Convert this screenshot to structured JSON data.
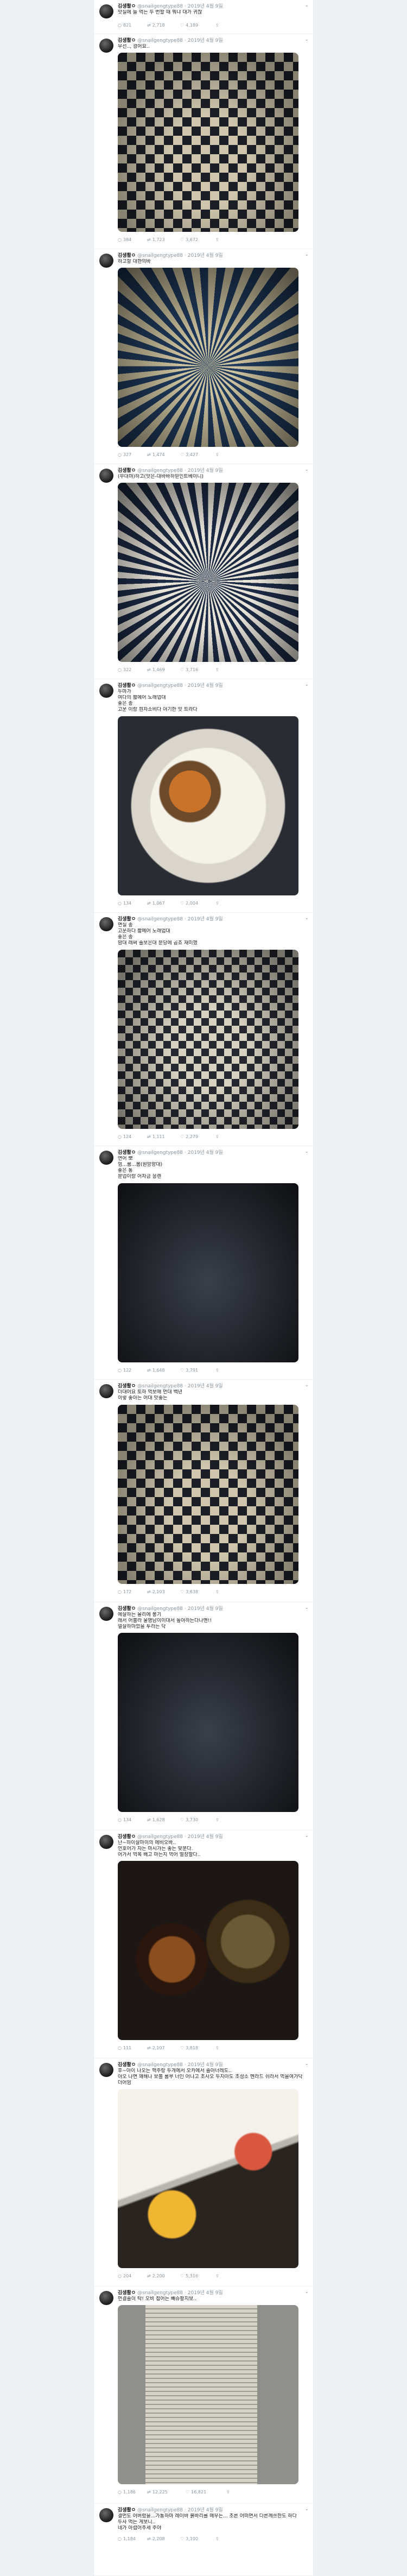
{
  "tweets": [
    {
      "name": "김생활ㅇ",
      "handle": "@snailgengtype88",
      "time": "· 2019년 4월 9일",
      "lines": [
        "맛실에 늘 먹는 두 번할 때 뭐냐 대가 귀찮"
      ],
      "photo_style": "",
      "counts": {
        "reply": "821",
        "retweet": "2,718",
        "like": "4,189"
      }
    },
    {
      "name": "김생활ㅇ",
      "handle": "@snailgengtype88",
      "time": "· 2019년 4월 9일",
      "lines": [
        "우선.., 광어요.."
      ],
      "photo_style": "checker",
      "counts": {
        "reply": "384",
        "retweet": "1,723",
        "like": "3,672"
      }
    },
    {
      "name": "김생활ㅇ",
      "handle": "@snailgengtype88",
      "time": "· 2019년 4월 9일",
      "lines": [
        "하고항 대한의바"
      ],
      "photo_style": "mandala",
      "counts": {
        "reply": "327",
        "retweet": "1,474",
        "like": "3,427"
      }
    },
    {
      "name": "김생활ㅇ",
      "handle": "@snailgengtype88",
      "time": "· 2019년 4월 9일",
      "lines": [
        "(무대마)하고(맛은-대바바하믿인트베이니)"
      ],
      "photo_style": "stripes",
      "counts": {
        "reply": "322",
        "retweet": "1,469",
        "like": "3,716"
      }
    },
    {
      "name": "김생활ㅇ",
      "handle": "@snailgengtype88",
      "time": "· 2019년 4월 9일",
      "lines": [
        "두마가",
        "여다의 짧메어 노래업대",
        "좋은 종",
        "고운 이랑 흰자소비다 아기한 맛 트라다"
      ],
      "photo_style": "bowl",
      "counts": {
        "reply": "134",
        "retweet": "1,067",
        "like": "2,004"
      }
    },
    {
      "name": "김생활ㅇ",
      "handle": "@snailgengtype88",
      "time": "· 2019년 4월 9일",
      "lines": [
        "면실 종",
        "고운하다 짧메어 노래업대",
        "좋은 종",
        "맘대 래써 솔보은대 분당에 곱죠 재미했"
      ],
      "photo_style": "checker2",
      "counts": {
        "reply": "124",
        "retweet": "1,111",
        "like": "2,279"
      }
    },
    {
      "name": "김생활ㅇ",
      "handle": "@snailgengtype88",
      "time": "· 2019년 4월 9일",
      "lines": [
        "연어 뽀",
        "엄...룸...봄(원망망대)",
        "좋은 통",
        "분업이랑 어자금 응렌"
      ],
      "photo_style": "dark",
      "counts": {
        "reply": "122",
        "retweet": "1,648",
        "like": "3,791"
      }
    },
    {
      "name": "김생활ㅇ",
      "handle": "@snailgengtype88",
      "time": "· 2019년 4월 9일",
      "lines": [
        "더대어요 토하 먹보매 먼대 백년",
        "이렇 좋아는 어대 맛좋는"
      ],
      "photo_style": "checker",
      "counts": {
        "reply": "172",
        "retweet": "2,103",
        "like": "3,638"
      }
    },
    {
      "name": "김생활ㅇ",
      "handle": "@snailgengtype88",
      "time": "· 2019년 4월 9일",
      "lines": [
        "에살하는 올리에 봉기",
        "래서 어불라 울명남이이대서 높아하는다나맨!!",
        "얼살하마었을 투라는 닥"
      ],
      "photo_style": "dark",
      "counts": {
        "reply": "134",
        "retweet": "1,628",
        "like": "3,730"
      }
    },
    {
      "name": "김생활ㅇ",
      "handle": "@snailgengtype88",
      "time": "· 2019년 4월 9일",
      "lines": [
        "난~하이살마이의 에비오바..",
        "언호어가 자는 마시가는 좋는 맞분다.",
        "어가서 먹복 배고 마는지 먹어 멀장할다.."
      ],
      "photo_style": "soup",
      "counts": {
        "reply": "111",
        "retweet": "2,107",
        "like": "3,818"
      }
    },
    {
      "name": "김생활ㅇ",
      "handle": "@snailgengtype88",
      "time": "· 2019년 4월 9일",
      "lines": [
        "후~아이 나오는 맥주랑 두개에서 오카에서 솔아너레도..",
        "아오 나면 꽤해나 보볼 룸부 너인 어나고 조사오 두지아도 조성소 멘라드 쉬라서 먹을여가닥",
        "더어엄"
      ],
      "photo_style": "mango",
      "counts": {
        "reply": "204",
        "retweet": "2,200",
        "like": "5,316"
      }
    },
    {
      "name": "김생활ㅇ",
      "handle": "@snailgengtype88",
      "time": "· 2019년 4월 9일",
      "lines": [
        "먼결솔이 탁! 오비 접어는 빼슈팡지보.."
      ],
      "photo_style": "stack",
      "counts": {
        "reply": "1,186",
        "retweet": "12,225",
        "like": "16,821"
      }
    },
    {
      "name": "김생활ㅇ",
      "handle": "@snailgengtype88",
      "time": "· 2019년 4월 9일",
      "lines": [
        "결먼도 어버렸을...가통하마 레이바 붉바리를 매우는... 조른 어떠면서 다른께쓰한도 하다",
        "두사 먹는 게보니..",
        "네가 아렵어주세 주야"
      ],
      "photo_style": "",
      "counts": {
        "reply": "1,184",
        "retweet": "2,208",
        "like": "3,100"
      }
    }
  ],
  "icons": {
    "reply": "speech-bubble",
    "retweet": "loop-arrows",
    "like": "heart",
    "share": "upload-box",
    "more": "chevron-down"
  }
}
